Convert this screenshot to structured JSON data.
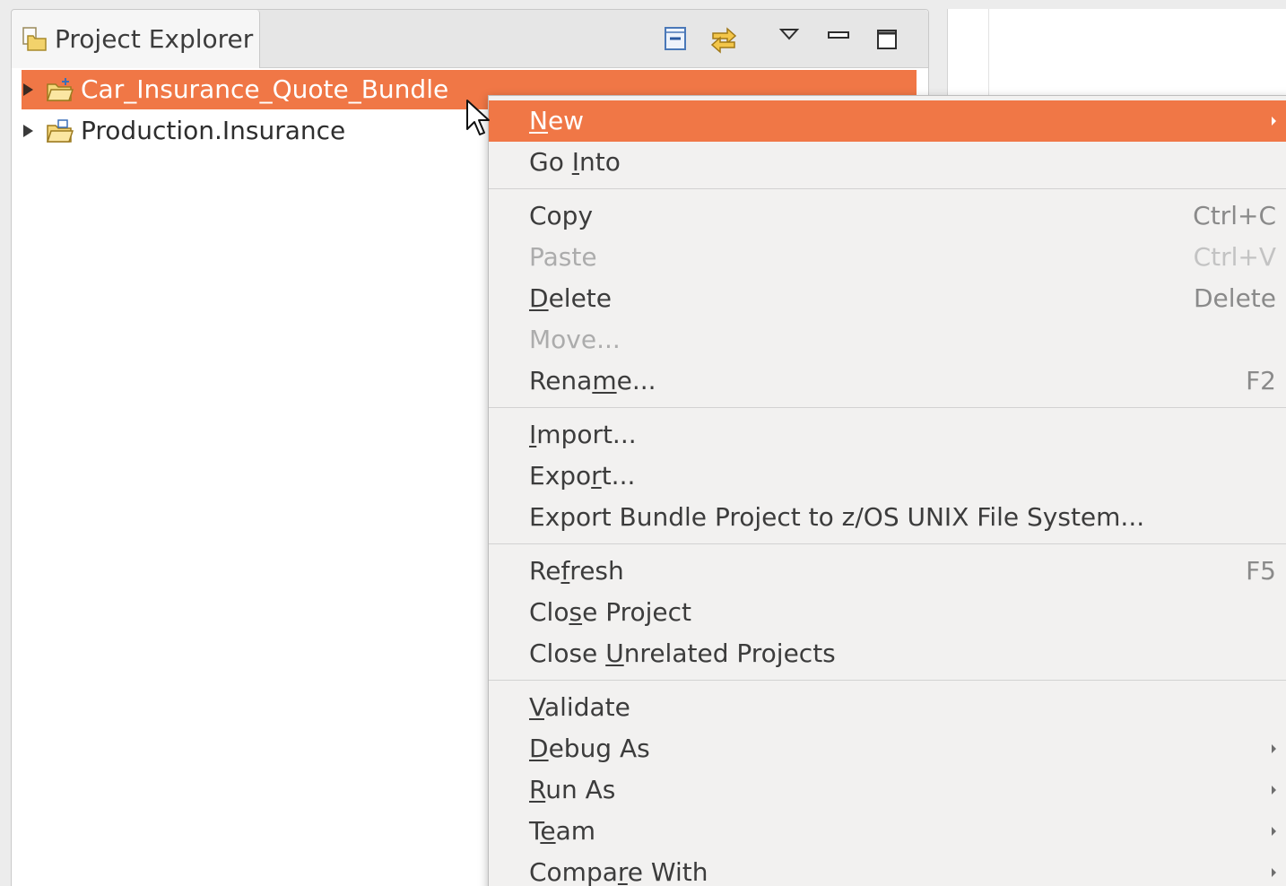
{
  "view": {
    "title": "Project Explorer",
    "toolbar": {
      "collapse_icon": "collapse-all-icon",
      "link_icon": "link-with-editor-icon",
      "menu_icon": "view-menu-icon",
      "minimize_icon": "minimize-icon",
      "maximize_icon": "maximize-icon"
    }
  },
  "tree": {
    "items": [
      {
        "label": "Car_Insurance_Quote_Bundle",
        "selected": true,
        "icon": "bundle-project-icon"
      },
      {
        "label": "Production.Insurance",
        "selected": false,
        "icon": "folder-project-icon"
      }
    ]
  },
  "menu": {
    "items": [
      {
        "label": "New",
        "mnemonic_index": 0,
        "shortcut": "",
        "submenu": true
      },
      {
        "label": "Go Into",
        "mnemonic_index": 3,
        "shortcut": "",
        "submenu": false
      },
      {
        "label": "Copy",
        "shortcut": "Ctrl+C"
      },
      {
        "label": "Paste",
        "shortcut": "Ctrl+V",
        "disabled": true
      },
      {
        "label": "Delete",
        "mnemonic_index": 0,
        "shortcut": "Delete"
      },
      {
        "label": "Move...",
        "shortcut": "",
        "disabled": true
      },
      {
        "label": "Rename...",
        "mnemonic_index": 4,
        "shortcut": "F2"
      },
      {
        "label": "Import...",
        "mnemonic_index": 0,
        "shortcut": ""
      },
      {
        "label": "Export...",
        "mnemonic_index": 4,
        "shortcut": ""
      },
      {
        "label": "Export Bundle Project to z/OS UNIX File System...",
        "shortcut": ""
      },
      {
        "label": "Refresh",
        "mnemonic_index": 2,
        "shortcut": "F5"
      },
      {
        "label": "Close Project",
        "mnemonic_index": 3,
        "shortcut": ""
      },
      {
        "label": "Close Unrelated Projects",
        "mnemonic_index": 6,
        "shortcut": ""
      },
      {
        "label": "Validate",
        "mnemonic_index": 0,
        "shortcut": ""
      },
      {
        "label": "Debug As",
        "mnemonic_index": 0,
        "shortcut": "",
        "submenu": true
      },
      {
        "label": "Run As",
        "mnemonic_index": 0,
        "shortcut": "",
        "submenu": true
      },
      {
        "label": "Team",
        "mnemonic_index": 1,
        "shortcut": "",
        "submenu": true
      },
      {
        "label": "Compare With",
        "mnemonic_index": 5,
        "shortcut": "",
        "submenu": true
      }
    ]
  },
  "colors": {
    "selection": "#f07746",
    "menu_background": "#f2f1f0",
    "text": "#3c3c3c",
    "disabled_text": "#acacac",
    "shortcut_text": "#8a8a8a"
  }
}
